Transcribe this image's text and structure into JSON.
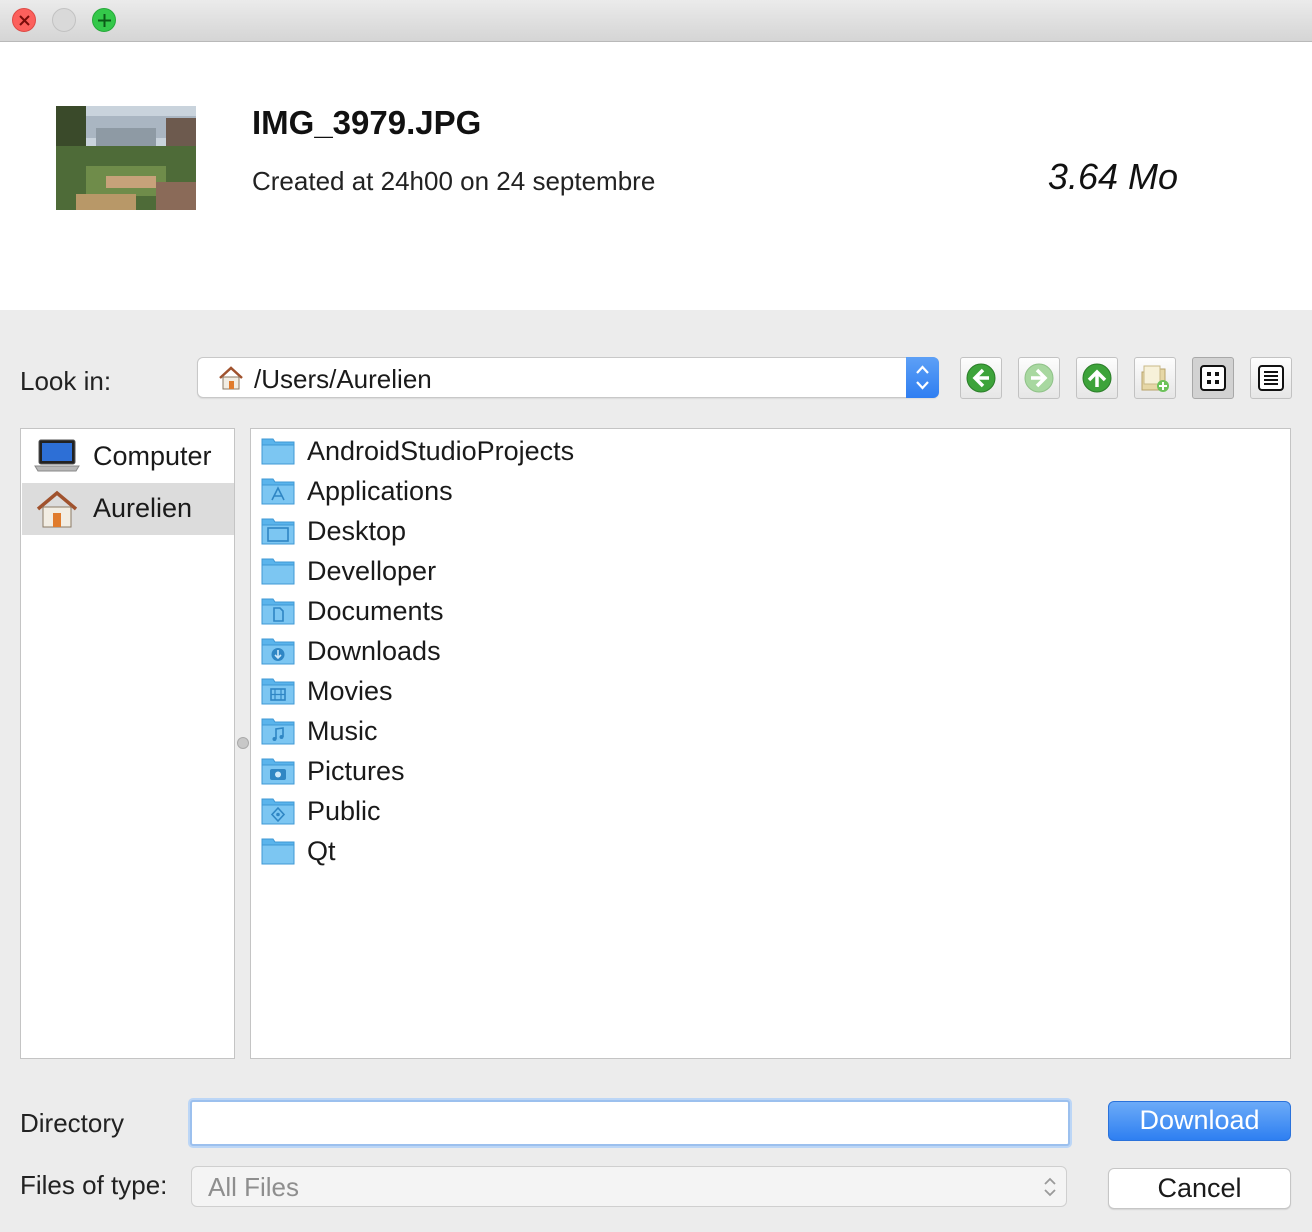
{
  "window": {
    "controls": [
      "close",
      "minimize",
      "maximize"
    ]
  },
  "preview": {
    "filename": "IMG_3979.JPG",
    "created": "Created at 24h00 on 24 septembre",
    "size": "3.64 Mo"
  },
  "lookin": {
    "label": "Look in:",
    "path": "/Users/Aurelien",
    "path_icon": "home-icon"
  },
  "toolbar": {
    "buttons": [
      {
        "name": "back",
        "icon": "back-arrow-icon"
      },
      {
        "name": "forward",
        "icon": "forward-arrow-icon"
      },
      {
        "name": "parent",
        "icon": "up-arrow-icon"
      },
      {
        "name": "new-folder",
        "icon": "new-folder-icon"
      },
      {
        "name": "list-mode",
        "icon": "grid-view-icon",
        "active": true
      },
      {
        "name": "detail-mode",
        "icon": "detail-view-icon"
      }
    ]
  },
  "sidebar": {
    "items": [
      {
        "label": "Computer",
        "icon": "laptop-icon",
        "selected": false
      },
      {
        "label": "Aurelien",
        "icon": "home-icon",
        "selected": true
      }
    ]
  },
  "files": [
    {
      "label": "AndroidStudioProjects",
      "icon": "folder-icon"
    },
    {
      "label": "Applications",
      "icon": "applications-folder-icon"
    },
    {
      "label": "Desktop",
      "icon": "desktop-folder-icon"
    },
    {
      "label": "Develloper",
      "icon": "folder-icon"
    },
    {
      "label": "Documents",
      "icon": "documents-folder-icon"
    },
    {
      "label": "Downloads",
      "icon": "downloads-folder-icon"
    },
    {
      "label": "Movies",
      "icon": "movies-folder-icon"
    },
    {
      "label": "Music",
      "icon": "music-folder-icon"
    },
    {
      "label": "Pictures",
      "icon": "pictures-folder-icon"
    },
    {
      "label": "Public",
      "icon": "public-folder-icon"
    },
    {
      "label": "Qt",
      "icon": "folder-icon"
    }
  ],
  "bottom": {
    "directory_label": "Directory",
    "directory_value": "",
    "type_label": "Files of type:",
    "type_value": "All Files",
    "download_label": "Download",
    "cancel_label": "Cancel"
  },
  "colors": {
    "accent": "#3b8af4",
    "folder": "#5ab4ec",
    "selection": "#dcdcdc"
  }
}
